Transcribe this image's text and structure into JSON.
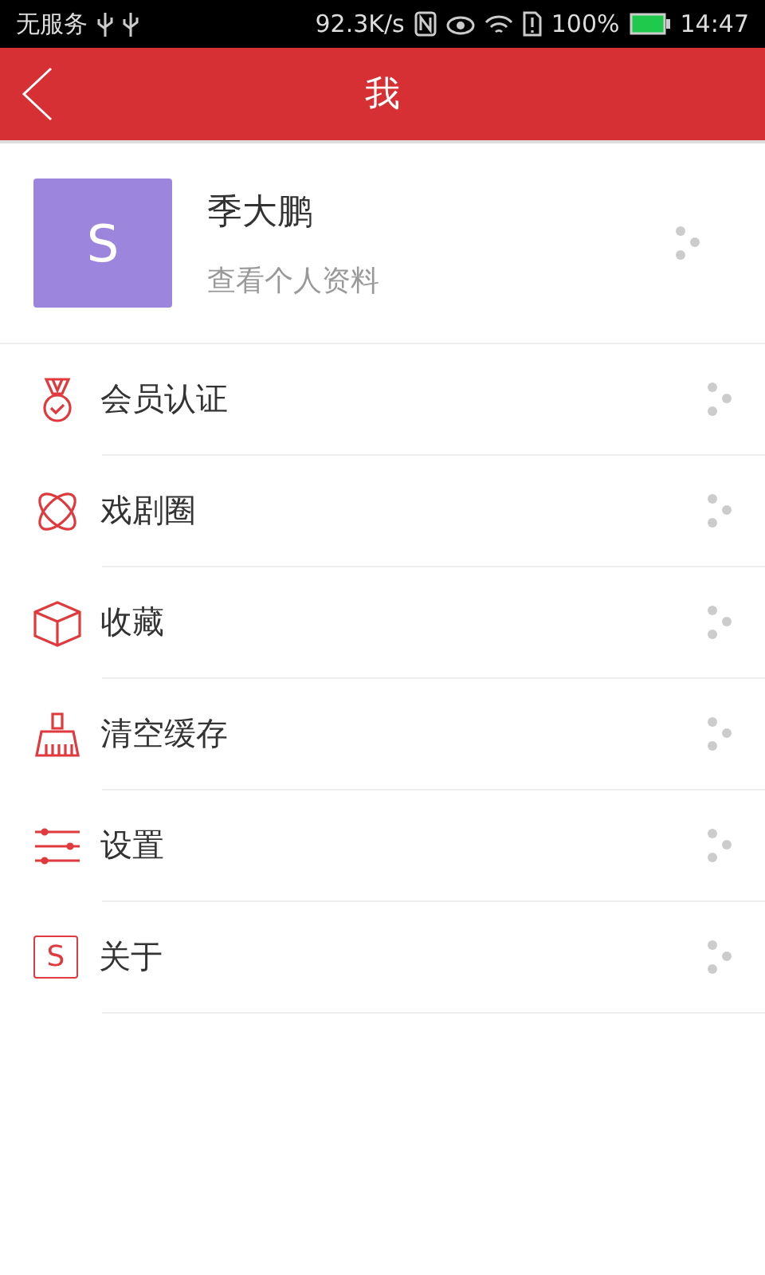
{
  "status_bar": {
    "carrier": "无服务",
    "speed": "92.3K/s",
    "battery": "100%",
    "time": "14:47"
  },
  "header": {
    "title": "我"
  },
  "profile": {
    "avatar_letter": "S",
    "name": "季大鹏",
    "subtitle": "查看个人资料"
  },
  "menu": [
    {
      "kind": "medal",
      "label": "会员认证"
    },
    {
      "kind": "orbit",
      "label": "戏剧圈"
    },
    {
      "kind": "box",
      "label": "收藏"
    },
    {
      "kind": "broom",
      "label": "清空缓存"
    },
    {
      "kind": "sliders",
      "label": "设置"
    },
    {
      "kind": "letter",
      "label": "关于",
      "icon_text": "S"
    }
  ]
}
